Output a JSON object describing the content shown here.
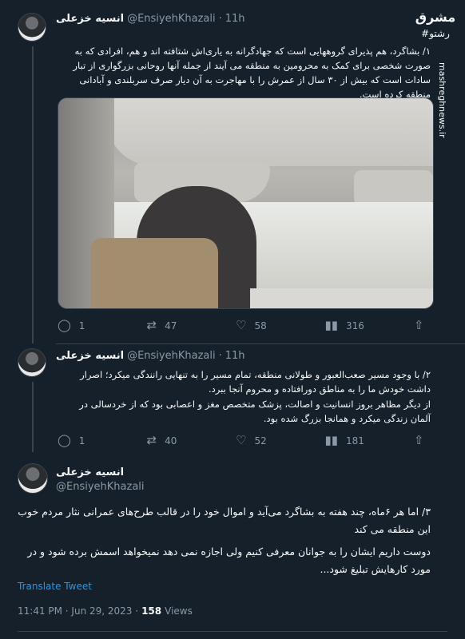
{
  "tweet1": {
    "display_name": "انسیه خزعلی",
    "handle": "@EnsiyehKhazali",
    "time": "11h",
    "text": "۱/ بشاگرد، هم پذیرای گروههایی است که جهادگرانه به یاری‌اش شتافته اند و هم، افرادی که به صورت شخصی برای کمک به محرومین به منطقه می آیند از جمله آنها روحانی بزرگواری از تبار سادات است که بیش از ۳۰ سال از عمرش را با مهاجرت به آن دیار صرف سربلندی و آبادانی منطقه کرده است.",
    "replies": "1",
    "retweets": "47",
    "likes": "58",
    "views": "316"
  },
  "tweet2": {
    "display_name": "انسیه خزعلی",
    "handle": "@EnsiyehKhazali",
    "time": "11h",
    "text_1": "۲/ با وجود مسیر صعب‌العبور و طولانی منطقه، تمام مسیر را به تنهایی رانندگی میکرد؛ اصرار داشت خودش ما را به مناطق دورافتاده و محروم آنجا ببرد.",
    "text_2": "از دیگر مظاهر بروز انسانیت و اصالت، پزشک متخصص مغز و اعصابی بود که از خردسالی در آلمان زندگی میکرد و همانجا بزرگ شده بود.",
    "replies": "1",
    "retweets": "40",
    "likes": "52",
    "views": "181"
  },
  "tweet3": {
    "display_name": "انسیه خزعلی",
    "handle": "@EnsiyehKhazali",
    "text_1": "۳/ اما هر ۶ماه، چند هفته به بشاگرد می‌آید و اموال خود را در قالب طرح‌های عمرانی نثار مردم خوب این منطقه می کند",
    "text_2": "دوست داریم ایشان را به جوانان معرفی کنیم ولی اجازه نمی دهد نمیخواهد اسمش برده شود و در مورد کارهایش تبلیغ شود...",
    "translate": "Translate Tweet",
    "timestamp": "11:41 PM · Jun 29, 2023 ·",
    "views_count": "158",
    "views_label": "Views"
  },
  "watermark": {
    "brand": "مشرق",
    "hashtag": "#رشتو",
    "site": "mashreghnews.ir"
  },
  "icons": {
    "reply": "reply-icon",
    "retweet": "retweet-icon",
    "like": "heart-icon",
    "views": "views-icon",
    "share": "share-icon"
  },
  "colors": {
    "background": "#15202b",
    "text": "#f7f9f9",
    "muted": "#8b98a5",
    "link": "#1d9bf0",
    "border": "#38444d"
  }
}
